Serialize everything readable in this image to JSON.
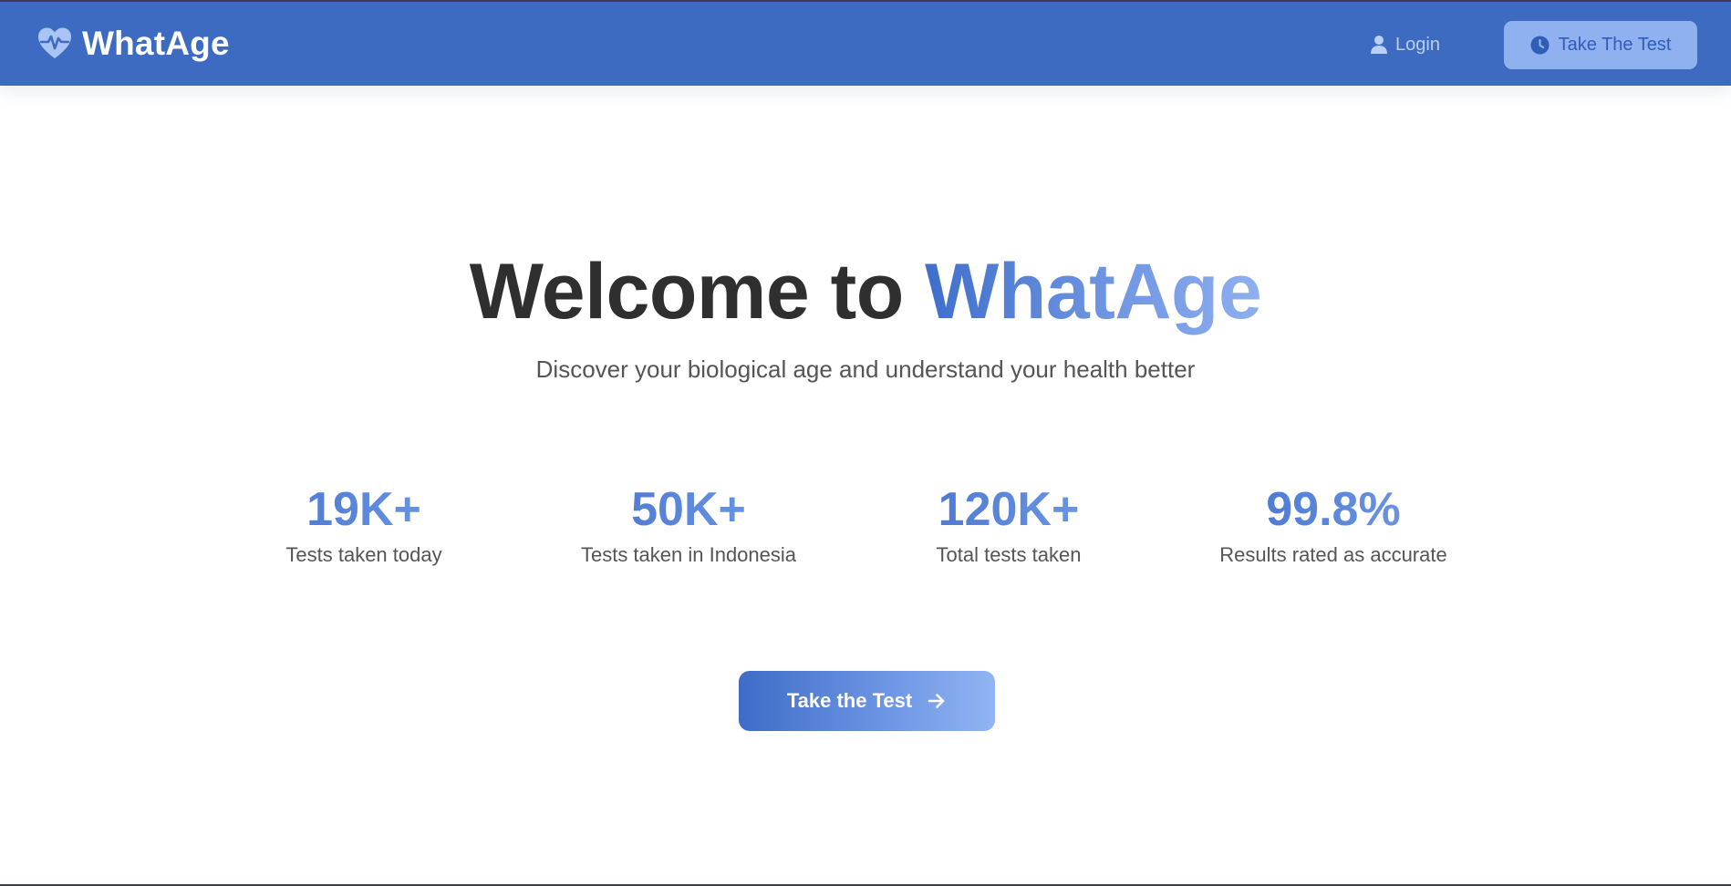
{
  "colors": {
    "header_bg": "#3d6bc2",
    "accent_start": "#3f6fcb",
    "accent_end": "#8eb0f0",
    "heading_text": "#2f2f2f",
    "body_text": "#555555",
    "top_button_bg": "#8fb1f0",
    "top_button_text": "#2f5db8",
    "login_text": "#b9cff5"
  },
  "header": {
    "brand": {
      "title": "WhatAge",
      "icon": "heart-pulse-icon"
    },
    "login": {
      "label": "Login",
      "icon": "user-icon"
    },
    "take_test": {
      "label": "Take The Test",
      "icon": "clock-icon"
    }
  },
  "hero": {
    "title_prefix": "Welcome to ",
    "title_accent": "WhatAge",
    "subtitle": "Discover your biological age and understand your health better"
  },
  "stats": [
    {
      "value": "19K+",
      "label": "Tests taken today"
    },
    {
      "value": "50K+",
      "label": "Tests taken in Indonesia"
    },
    {
      "value": "120K+",
      "label": "Total tests taken"
    },
    {
      "value": "99.8%",
      "label": "Results rated as accurate"
    }
  ],
  "cta": {
    "label": "Take the Test",
    "icon": "arrow-right-icon"
  }
}
